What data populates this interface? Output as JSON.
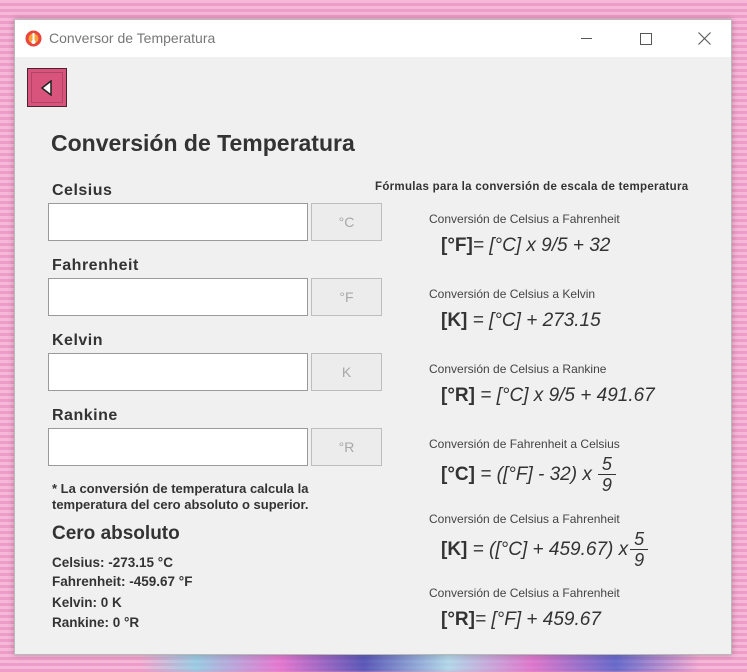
{
  "window": {
    "title": "Conversor de Temperatura",
    "controls": {
      "minimize": "—",
      "maximize": "☐",
      "close": "✕"
    }
  },
  "back_button": {
    "icon": "triangle-left-icon"
  },
  "heading": "Conversión de Temperatura",
  "fields": [
    {
      "label": "Celsius",
      "value": "",
      "unit": "°C"
    },
    {
      "label": "Fahrenheit",
      "value": "",
      "unit": "°F"
    },
    {
      "label": "Kelvin",
      "value": "",
      "unit": "K"
    },
    {
      "label": "Rankine",
      "value": "",
      "unit": "°R"
    }
  ],
  "note": "* La conversión de temperatura calcula la temperatura del cero absoluto o superior.",
  "absolute_zero": {
    "title": "Cero absoluto",
    "lines": [
      "Celsius: -273.15 °C",
      "Fahrenheit: -459.67 °F",
      "Kelvin: 0 K",
      "Rankine: 0 °R"
    ]
  },
  "formulas": {
    "title": "Fórmulas para la conversión de escala de temperatura",
    "items": [
      {
        "subtitle": "Conversión de Celsius a Fahrenheit",
        "lhs": "[°F]",
        "rhs": "= [°C] x 9/5 + 32"
      },
      {
        "subtitle": "Conversión de Celsius a Kelvin",
        "lhs": "[K]",
        "rhs": " = [°C] + 273.15"
      },
      {
        "subtitle": "Conversión de Celsius a Rankine",
        "lhs": "[°R]",
        "rhs": " = [°C] x 9/5 + 491.67"
      },
      {
        "subtitle": "Conversión de Fahrenheit a Celsius",
        "lhs": "[°C]",
        "rhs": " = ([°F] - 32) x",
        "frac_num": "5",
        "frac_den": "9"
      },
      {
        "subtitle": "Conversión de Celsius a Fahrenheit",
        "lhs": "[K]",
        "rhs": " = ([°C] + 459.67) x",
        "frac_num": "5",
        "frac_den": "9"
      },
      {
        "subtitle": "Conversión de Celsius a Fahrenheit",
        "lhs": "[°R]",
        "rhs": "= [°F] + 459.67"
      }
    ]
  },
  "colors": {
    "back_button": "#d9547d",
    "window_bg": "#f0f0f0",
    "desktop_bg": "#f2a5cf"
  }
}
